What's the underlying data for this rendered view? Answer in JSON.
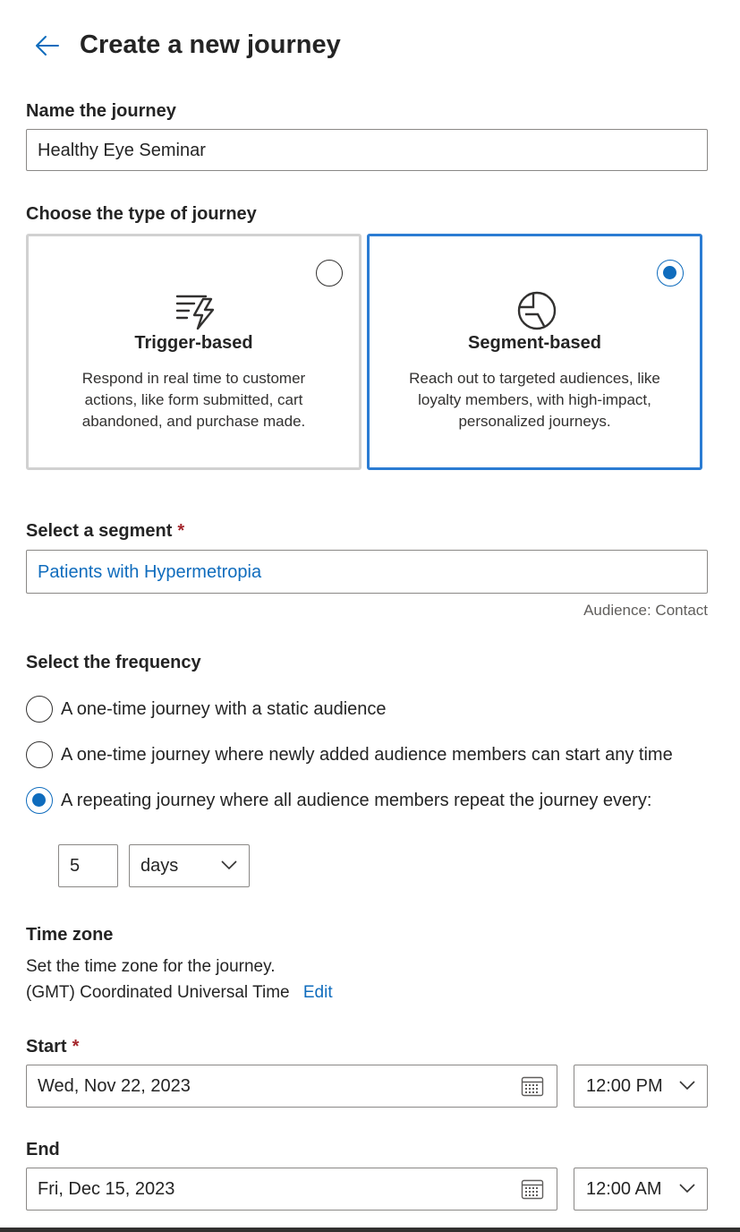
{
  "header": {
    "title": "Create a new journey"
  },
  "name_field": {
    "label": "Name the journey",
    "value": "Healthy Eye Seminar"
  },
  "journey_type": {
    "label": "Choose the type of journey",
    "options": [
      {
        "title": "Trigger-based",
        "description": "Respond in real time to customer actions, like form submitted, cart abandoned, and purchase made.",
        "selected": false,
        "icon": "trigger-lightning-icon"
      },
      {
        "title": "Segment-based",
        "description": "Reach out to targeted audiences, like loyalty members, with high-impact, personalized journeys.",
        "selected": true,
        "icon": "segment-pie-icon"
      }
    ]
  },
  "segment": {
    "label": "Select a segment",
    "required_mark": "*",
    "value": "Patients with Hypermetropia",
    "audience_note": "Audience: Contact"
  },
  "frequency": {
    "label": "Select the frequency",
    "options": [
      {
        "label": "A one-time journey with a static audience",
        "selected": false
      },
      {
        "label": "A one-time journey where newly added audience members can start any time",
        "selected": false
      },
      {
        "label": "A repeating journey where all audience members repeat the journey every:",
        "selected": true
      }
    ],
    "repeat_count": "5",
    "repeat_unit": "days"
  },
  "timezone": {
    "label": "Time zone",
    "description": "Set the time zone for the journey.",
    "value": "(GMT) Coordinated Universal Time",
    "edit_label": "Edit"
  },
  "start": {
    "label": "Start",
    "required_mark": "*",
    "date": "Wed, Nov 22, 2023",
    "time": "12:00 PM"
  },
  "end": {
    "label": "End",
    "date": "Fri, Dec 15, 2023",
    "time": "12:00 AM"
  },
  "colors": {
    "accent": "#0f6cbd",
    "selected_border": "#2b7cd3",
    "required": "#a4262c",
    "link": "#0f6cbd"
  }
}
